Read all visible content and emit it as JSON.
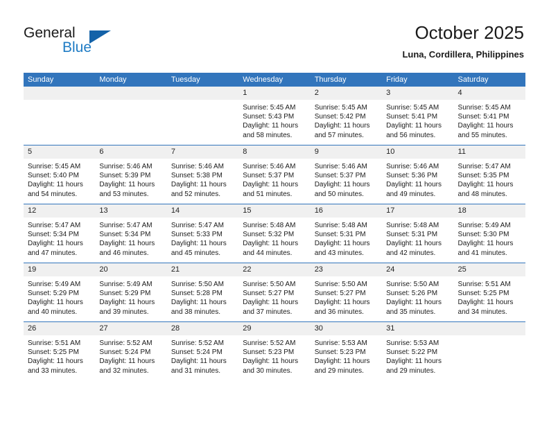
{
  "brand": {
    "name_part1": "General",
    "name_part2": "Blue",
    "triangle_icon": "triangle-icon"
  },
  "header": {
    "title": "October 2025",
    "subtitle": "Luna, Cordillera, Philippines"
  },
  "colors": {
    "header_blue": "#3275bc",
    "logo_blue": "#1e7bc4",
    "daynum_bg": "#f0f0f0",
    "page_bg": "#ffffff"
  },
  "calendar": {
    "weekday_headers": [
      "Sunday",
      "Monday",
      "Tuesday",
      "Wednesday",
      "Thursday",
      "Friday",
      "Saturday"
    ],
    "weeks": [
      [
        {
          "day": "",
          "info": ""
        },
        {
          "day": "",
          "info": ""
        },
        {
          "day": "",
          "info": ""
        },
        {
          "day": "1",
          "info": "Sunrise: 5:45 AM\nSunset: 5:43 PM\nDaylight: 11 hours\nand 58 minutes."
        },
        {
          "day": "2",
          "info": "Sunrise: 5:45 AM\nSunset: 5:42 PM\nDaylight: 11 hours\nand 57 minutes."
        },
        {
          "day": "3",
          "info": "Sunrise: 5:45 AM\nSunset: 5:41 PM\nDaylight: 11 hours\nand 56 minutes."
        },
        {
          "day": "4",
          "info": "Sunrise: 5:45 AM\nSunset: 5:41 PM\nDaylight: 11 hours\nand 55 minutes."
        }
      ],
      [
        {
          "day": "5",
          "info": "Sunrise: 5:45 AM\nSunset: 5:40 PM\nDaylight: 11 hours\nand 54 minutes."
        },
        {
          "day": "6",
          "info": "Sunrise: 5:46 AM\nSunset: 5:39 PM\nDaylight: 11 hours\nand 53 minutes."
        },
        {
          "day": "7",
          "info": "Sunrise: 5:46 AM\nSunset: 5:38 PM\nDaylight: 11 hours\nand 52 minutes."
        },
        {
          "day": "8",
          "info": "Sunrise: 5:46 AM\nSunset: 5:37 PM\nDaylight: 11 hours\nand 51 minutes."
        },
        {
          "day": "9",
          "info": "Sunrise: 5:46 AM\nSunset: 5:37 PM\nDaylight: 11 hours\nand 50 minutes."
        },
        {
          "day": "10",
          "info": "Sunrise: 5:46 AM\nSunset: 5:36 PM\nDaylight: 11 hours\nand 49 minutes."
        },
        {
          "day": "11",
          "info": "Sunrise: 5:47 AM\nSunset: 5:35 PM\nDaylight: 11 hours\nand 48 minutes."
        }
      ],
      [
        {
          "day": "12",
          "info": "Sunrise: 5:47 AM\nSunset: 5:34 PM\nDaylight: 11 hours\nand 47 minutes."
        },
        {
          "day": "13",
          "info": "Sunrise: 5:47 AM\nSunset: 5:34 PM\nDaylight: 11 hours\nand 46 minutes."
        },
        {
          "day": "14",
          "info": "Sunrise: 5:47 AM\nSunset: 5:33 PM\nDaylight: 11 hours\nand 45 minutes."
        },
        {
          "day": "15",
          "info": "Sunrise: 5:48 AM\nSunset: 5:32 PM\nDaylight: 11 hours\nand 44 minutes."
        },
        {
          "day": "16",
          "info": "Sunrise: 5:48 AM\nSunset: 5:31 PM\nDaylight: 11 hours\nand 43 minutes."
        },
        {
          "day": "17",
          "info": "Sunrise: 5:48 AM\nSunset: 5:31 PM\nDaylight: 11 hours\nand 42 minutes."
        },
        {
          "day": "18",
          "info": "Sunrise: 5:49 AM\nSunset: 5:30 PM\nDaylight: 11 hours\nand 41 minutes."
        }
      ],
      [
        {
          "day": "19",
          "info": "Sunrise: 5:49 AM\nSunset: 5:29 PM\nDaylight: 11 hours\nand 40 minutes."
        },
        {
          "day": "20",
          "info": "Sunrise: 5:49 AM\nSunset: 5:29 PM\nDaylight: 11 hours\nand 39 minutes."
        },
        {
          "day": "21",
          "info": "Sunrise: 5:50 AM\nSunset: 5:28 PM\nDaylight: 11 hours\nand 38 minutes."
        },
        {
          "day": "22",
          "info": "Sunrise: 5:50 AM\nSunset: 5:27 PM\nDaylight: 11 hours\nand 37 minutes."
        },
        {
          "day": "23",
          "info": "Sunrise: 5:50 AM\nSunset: 5:27 PM\nDaylight: 11 hours\nand 36 minutes."
        },
        {
          "day": "24",
          "info": "Sunrise: 5:50 AM\nSunset: 5:26 PM\nDaylight: 11 hours\nand 35 minutes."
        },
        {
          "day": "25",
          "info": "Sunrise: 5:51 AM\nSunset: 5:25 PM\nDaylight: 11 hours\nand 34 minutes."
        }
      ],
      [
        {
          "day": "26",
          "info": "Sunrise: 5:51 AM\nSunset: 5:25 PM\nDaylight: 11 hours\nand 33 minutes."
        },
        {
          "day": "27",
          "info": "Sunrise: 5:52 AM\nSunset: 5:24 PM\nDaylight: 11 hours\nand 32 minutes."
        },
        {
          "day": "28",
          "info": "Sunrise: 5:52 AM\nSunset: 5:24 PM\nDaylight: 11 hours\nand 31 minutes."
        },
        {
          "day": "29",
          "info": "Sunrise: 5:52 AM\nSunset: 5:23 PM\nDaylight: 11 hours\nand 30 minutes."
        },
        {
          "day": "30",
          "info": "Sunrise: 5:53 AM\nSunset: 5:23 PM\nDaylight: 11 hours\nand 29 minutes."
        },
        {
          "day": "31",
          "info": "Sunrise: 5:53 AM\nSunset: 5:22 PM\nDaylight: 11 hours\nand 29 minutes."
        },
        {
          "day": "",
          "info": ""
        }
      ]
    ]
  }
}
